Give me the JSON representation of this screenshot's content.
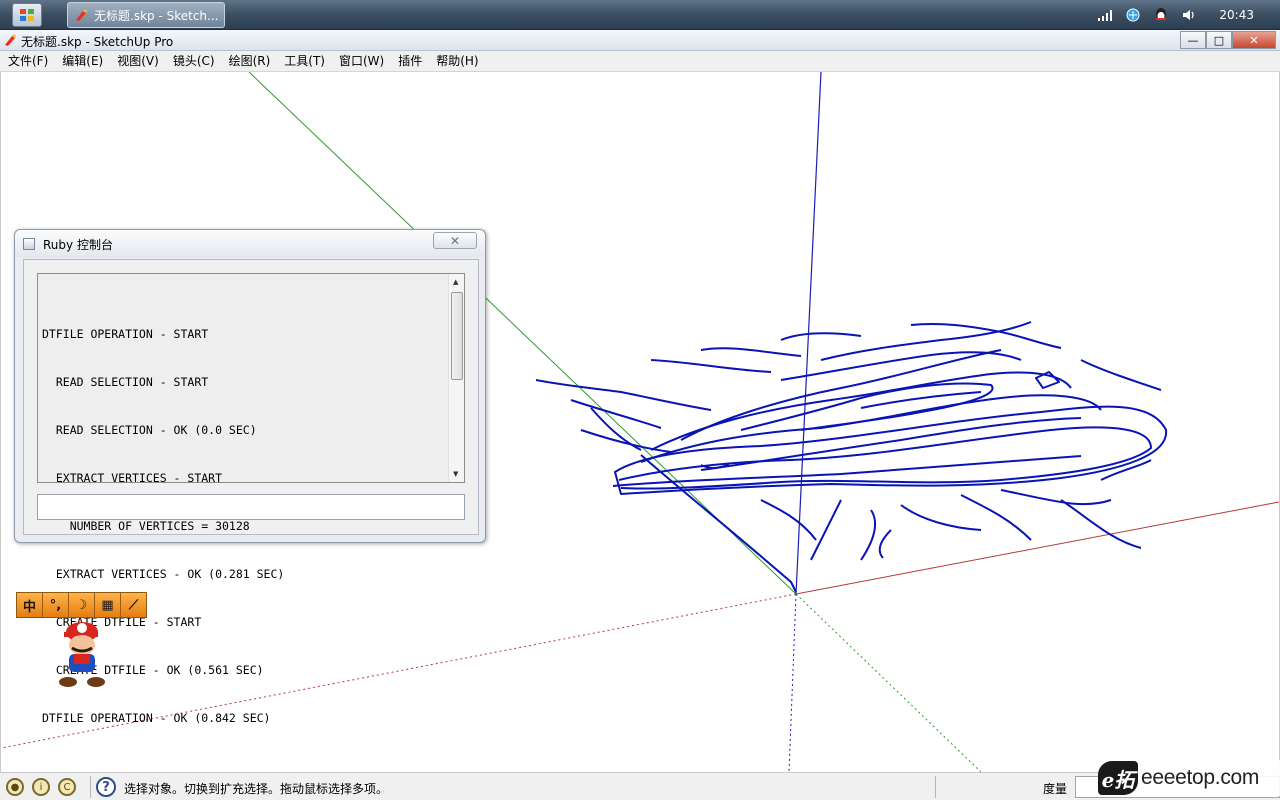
{
  "taskbar": {
    "task_title": "无标题.skp - Sketch...",
    "clock": "20:43",
    "tray_icons": [
      "signal-icon",
      "network-icon",
      "qq-icon",
      "volume-icon"
    ]
  },
  "window": {
    "title": "无标题.skp - SketchUp Pro",
    "minimize": "—",
    "maximize": "□",
    "close": "✕"
  },
  "menu": {
    "items": [
      "文件(F)",
      "编辑(E)",
      "视图(V)",
      "镜头(C)",
      "绘图(R)",
      "工具(T)",
      "窗口(W)",
      "插件",
      "帮助(H)"
    ]
  },
  "ruby_console": {
    "title": "Ruby 控制台",
    "close": "✕",
    "output": [
      "DTFILE OPERATION - START",
      "  READ SELECTION - START",
      "  READ SELECTION - OK (0.0 SEC)",
      "  EXTRACT VERTICES - START",
      "    NUMBER OF VERTICES = 30128",
      "  EXTRACT VERTICES - OK (0.281 SEC)",
      "  CREATE DTFILE - START",
      "  CREATE DTFILE - OK (0.561 SEC)",
      "DTFILE OPERATION - OK (0.842 SEC)"
    ],
    "input_value": ""
  },
  "ime_toolbar": {
    "buttons": [
      "中",
      "°,",
      "☽",
      "▦",
      "⟋"
    ]
  },
  "statusbar": {
    "message": "选择对象。切换到扩充选择。拖动鼠标选择多项。",
    "measure_label": "度量",
    "measure_value": ""
  },
  "watermark": {
    "logo": "e拓",
    "text": "eeeetop.com"
  },
  "colors": {
    "axis_red": "#b33a3a",
    "axis_green": "#2e9a2e",
    "axis_blue": "#1c1cb8",
    "contour": "#0a14b4"
  }
}
